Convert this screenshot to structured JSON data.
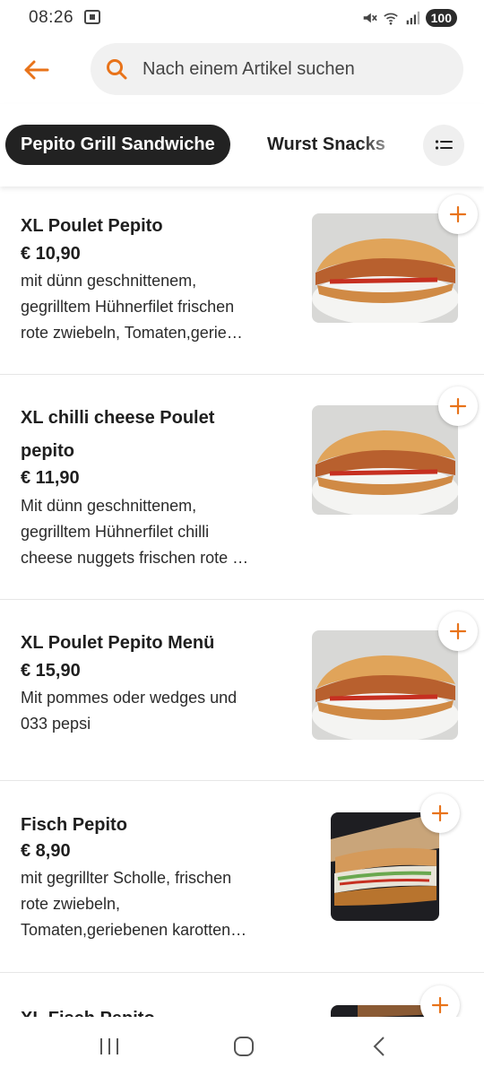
{
  "status_bar": {
    "time": "08:26",
    "battery": "100"
  },
  "search": {
    "placeholder": "Nach einem Artikel suchen"
  },
  "tabs": [
    {
      "label": "Pepito Grill Sandwiche",
      "active": true
    },
    {
      "label": "Wurst Snacks",
      "active": false
    }
  ],
  "items": [
    {
      "name": "XL Poulet Pepito",
      "price": "€ 10,90",
      "description": [
        "mit dünn geschnittenem,",
        "gegrilltem Hühnerfilet frischen",
        "rote zwiebeln, Tomaten,gerie…"
      ]
    },
    {
      "name_lines": [
        "XL chilli cheese Poulet",
        "pepito"
      ],
      "price": "€ 11,90",
      "description": [
        "Mit dünn geschnittenem,",
        "gegrilltem Hühnerfilet chilli",
        "cheese nuggets frischen rote …"
      ]
    },
    {
      "name": "XL Poulet Pepito Menü",
      "price": "€ 15,90",
      "description": [
        "Mit pommes oder wedges und",
        "033 pepsi"
      ]
    },
    {
      "name": "Fisch Pepito",
      "price": "€ 8,90",
      "description": [
        "mit gegrillter Scholle, frischen",
        "rote zwiebeln,",
        "Tomaten,geriebenen karotten…"
      ]
    },
    {
      "name": "XL Fisch Pepito"
    }
  ],
  "colors": {
    "accent": "#e8731a",
    "chip_bg": "#222222"
  },
  "icons": {
    "back": "arrow-left-icon",
    "search": "search-icon",
    "filter": "list-filter-icon",
    "add": "plus-icon"
  }
}
